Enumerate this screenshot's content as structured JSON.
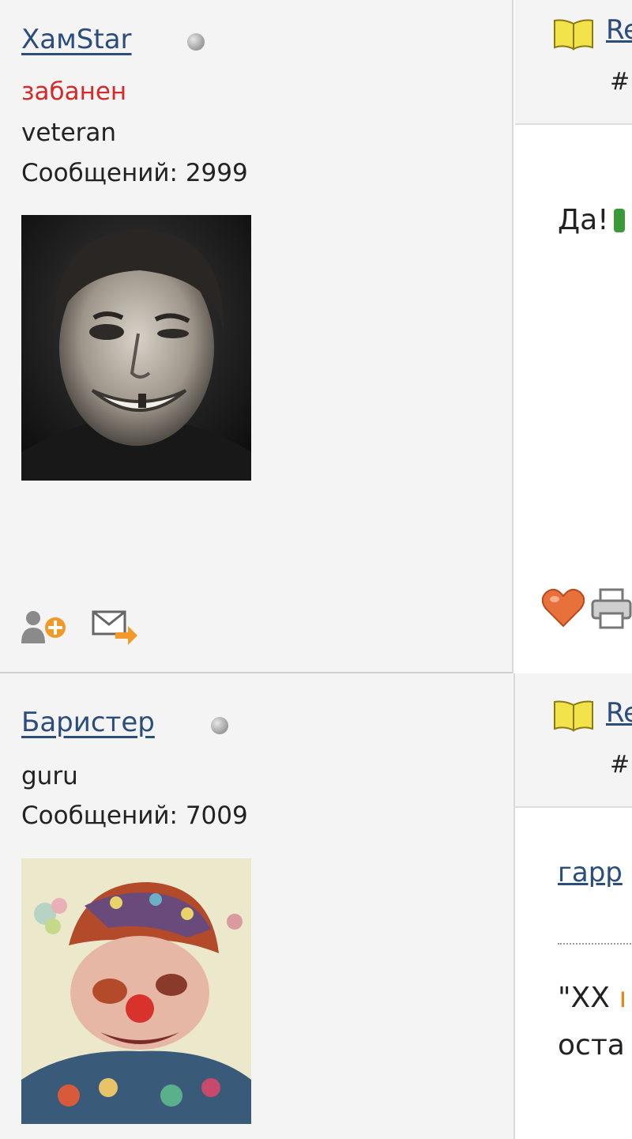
{
  "posts": [
    {
      "username": "XамStar",
      "banned_label": "забанен",
      "rank": "veteran",
      "posts_count": "Сообщений: 2999",
      "link_text": "Re",
      "post_number": "#",
      "message": "Да!"
    },
    {
      "username": "Баристер",
      "rank": "guru",
      "posts_count": "Сообщений: 7009",
      "link_text": "Re",
      "post_number": "#",
      "quote_link": "гарр",
      "sig_line1_a": "\"XX ",
      "sig_line1_b": "ı",
      "sig_line2": "оста"
    }
  ],
  "icons": {
    "add_friend": "add-friend-icon",
    "send_message": "send-message-icon",
    "thanks": "heart-icon",
    "print": "printer-icon",
    "post_marker": "open-book-icon",
    "online_status": "status-dot-icon"
  },
  "colors": {
    "link": "#2b4d7c",
    "banned": "#d42a2a",
    "sidebar_bg": "#f4f4f4"
  }
}
